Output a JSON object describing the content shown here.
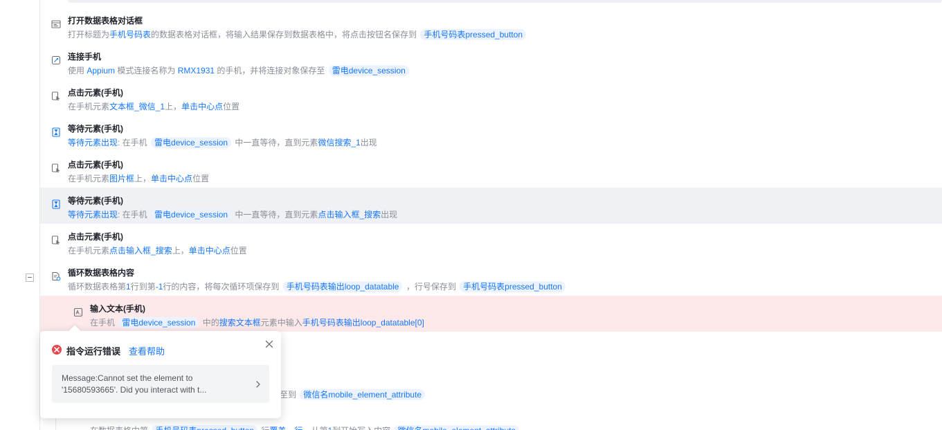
{
  "steps": [
    {
      "title": "打开数据表格对话框",
      "icon": "dialog-table-icon",
      "desc": [
        [
          "t",
          "打开标题为"
        ],
        [
          "l",
          "手机号码表"
        ],
        [
          "t",
          "的数据表格对话框，将输入结果保存到数据表格中，将点击按钮名保存到 "
        ],
        [
          "g",
          "手机号码表pressed_button"
        ]
      ]
    },
    {
      "title": "连接手机",
      "icon": "phone-connect-icon",
      "desc": [
        [
          "t",
          "使用 "
        ],
        [
          "l",
          "Appium"
        ],
        [
          "t",
          " 模式连接名称为 "
        ],
        [
          "l",
          "RMX1931"
        ],
        [
          "t",
          " 的手机，并将连接对象保存至 "
        ],
        [
          "g",
          "雷电device_session"
        ]
      ]
    },
    {
      "title": "点击元素(手机)",
      "icon": "click-element-icon",
      "desc": [
        [
          "t",
          "在手机元素"
        ],
        [
          "l",
          "文本框_微信_1"
        ],
        [
          "t",
          "上，"
        ],
        [
          "l",
          "单击中心点"
        ],
        [
          "t",
          "位置"
        ]
      ]
    },
    {
      "title": "等待元素(手机)",
      "icon": "hourglass-icon",
      "desc": [
        [
          "l",
          "等待元素出现"
        ],
        [
          "t",
          ": 在手机 "
        ],
        [
          "g",
          "雷电device_session"
        ],
        [
          "t",
          " 中一直等待，直到元素"
        ],
        [
          "l",
          "微信搜索_1"
        ],
        [
          "t",
          "出现"
        ]
      ]
    },
    {
      "title": "点击元素(手机)",
      "icon": "click-element-icon",
      "desc": [
        [
          "t",
          "在手机元素"
        ],
        [
          "l",
          "图片框"
        ],
        [
          "t",
          "上，"
        ],
        [
          "l",
          "单击中心点"
        ],
        [
          "t",
          "位置"
        ]
      ]
    },
    {
      "title": "等待元素(手机)",
      "icon": "hourglass-icon",
      "desc": [
        [
          "l",
          "等待元素出现"
        ],
        [
          "t",
          ": 在手机 "
        ],
        [
          "g",
          "雷电device_session"
        ],
        [
          "t",
          " 中一直等待，直到元素"
        ],
        [
          "l",
          "点击输入框_搜索"
        ],
        [
          "t",
          "出现"
        ]
      ]
    },
    {
      "title": "点击元素(手机)",
      "icon": "click-element-icon",
      "desc": [
        [
          "t",
          "在手机元素"
        ],
        [
          "l",
          "点击输入框_搜索"
        ],
        [
          "t",
          "上，"
        ],
        [
          "l",
          "单击中心点"
        ],
        [
          "t",
          "位置"
        ]
      ]
    },
    {
      "title": "循环数据表格内容",
      "icon": "loop-table-icon",
      "desc": [
        [
          "t",
          "循环数据表格第"
        ],
        [
          "l",
          "1"
        ],
        [
          "t",
          "行到第"
        ],
        [
          "l",
          "-1"
        ],
        [
          "t",
          "行的内容，将每次循环项保存到 "
        ],
        [
          "g",
          "手机号码表输出loop_datatable"
        ],
        [
          "t",
          " ，行号保存到 "
        ],
        [
          "g",
          "手机号码表pressed_button"
        ]
      ]
    },
    {
      "title": "输入文本(手机)",
      "icon": "input-text-icon",
      "desc": [
        [
          "t",
          "在手机 "
        ],
        [
          "g",
          "雷电device_session"
        ],
        [
          "t",
          " 中的"
        ],
        [
          "l",
          "搜索文本框"
        ],
        [
          "t",
          "元素中输入"
        ],
        [
          "l",
          "手机号码表输出loop_datatable[0]"
        ]
      ]
    }
  ],
  "partial_rows": [
    {
      "desc": [
        [
          "t",
          "至到 "
        ],
        [
          "g",
          "微信名mobile_element_attribute"
        ]
      ]
    },
    {
      "desc": [
        [
          "t",
          "在数据表格中第 "
        ],
        [
          "g",
          "手机号码表pressed_button"
        ],
        [
          "t",
          " 行"
        ],
        [
          "l",
          "覆盖一行"
        ],
        [
          "t",
          "，从第"
        ],
        [
          "l",
          "1"
        ],
        [
          "t",
          "列开始写入内容 "
        ],
        [
          "g",
          "微信名mobile_element_attribute"
        ]
      ]
    }
  ],
  "error_popup": {
    "title": "指令运行错误",
    "help_link": "查看帮助",
    "message": "Message:Cannot set the element to '15680593665'. Did you interact with t..."
  },
  "colors": {
    "link": "#1677ff",
    "tag_bg": "#ecf3fe",
    "error_row_bg": "#fde9ea",
    "highlight_row_bg": "#f0f1f4",
    "error_icon": "#e5484d"
  }
}
